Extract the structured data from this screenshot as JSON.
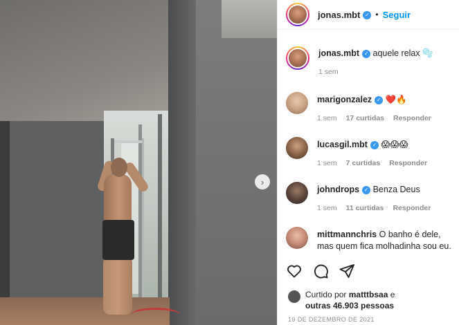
{
  "header": {
    "username": "jonas.mbt",
    "separator": "•",
    "follow_label": "Seguir"
  },
  "caption": {
    "username": "jonas.mbt",
    "text": "aquele relax 🫧",
    "time": "1 sem"
  },
  "comments": [
    {
      "username": "marigonzalez",
      "text": "❤️🔥",
      "time": "1 sem",
      "likes": "17 curtidas",
      "reply": "Responder"
    },
    {
      "username": "lucasgil.mbt",
      "text": "😱😱😱",
      "time": "1 sem",
      "likes": "7 curtidas",
      "reply": "Responder"
    },
    {
      "username": "johndrops",
      "text": "Benza Deus",
      "time": "1 sem",
      "likes": "11 curtidas",
      "reply": "Responder"
    },
    {
      "username": "mittmannchris",
      "text": "O banho é dele, mas quem fica molhadinha sou eu. 🔥"
    }
  ],
  "likes_summary": {
    "prefix": "Curtido por",
    "user": "matttbsaa",
    "connector": "e",
    "others": "outras 46.903 pessoas"
  },
  "date": "19 DE DEZEMBRO DE 2021",
  "icons": {
    "verified": "verified-badge-icon",
    "like": "heart-icon",
    "comment": "comment-icon",
    "share": "paper-plane-icon",
    "next": "chevron-right-icon"
  },
  "colors": {
    "accent": "#0095f6",
    "verified": "#3897f0",
    "muted": "#8e8e8e"
  }
}
